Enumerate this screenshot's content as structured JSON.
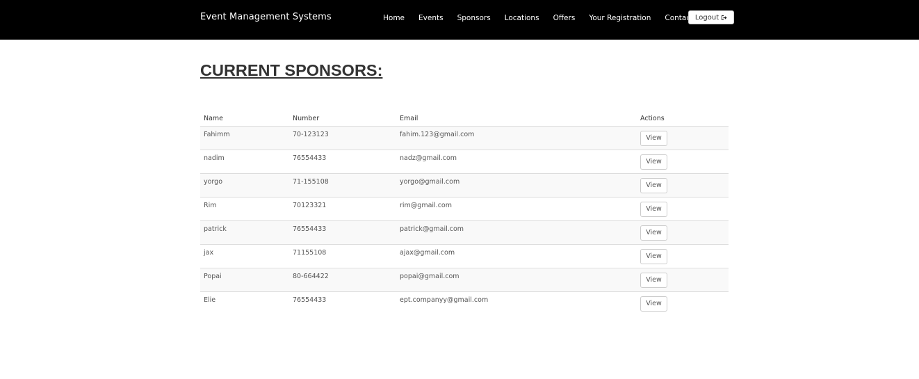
{
  "navbar": {
    "brand": "Event Management Systems",
    "links": [
      "Home",
      "Events",
      "Sponsors",
      "Locations",
      "Offers",
      "Your Registration",
      "Contact Us"
    ],
    "logout_label": "Logout"
  },
  "page": {
    "title": "CURRENT SPONSORS:"
  },
  "table": {
    "headers": [
      "Name",
      "Number",
      "Email",
      "Actions"
    ],
    "rows": [
      {
        "name": "Fahimm",
        "number": "70-123123",
        "email": "fahim.123@gmail.com",
        "action": "View"
      },
      {
        "name": "nadim",
        "number": "76554433",
        "email": "nadz@gmail.com",
        "action": "View"
      },
      {
        "name": "yorgo",
        "number": "71-155108",
        "email": "yorgo@gmail.com",
        "action": "View"
      },
      {
        "name": "Rim",
        "number": "70123321",
        "email": "rim@gmail.com",
        "action": "View"
      },
      {
        "name": "patrick",
        "number": "76554433",
        "email": "patrick@gmail.com",
        "action": "View"
      },
      {
        "name": "jax",
        "number": "71155108",
        "email": "ajax@gmail.com",
        "action": "View"
      },
      {
        "name": "Popai",
        "number": "80-664422",
        "email": "popai@gmail.com",
        "action": "View"
      },
      {
        "name": "Elie",
        "number": "76554433",
        "email": "ept.companyy@gmail.com",
        "action": "View"
      }
    ]
  },
  "colors": {
    "navbar_bg": "#000000",
    "navbar_text": "#ffffff",
    "stripe_row": "#f9f9f9",
    "row_border": "#dddddd"
  },
  "icons": {
    "logout": "sign-out-icon"
  }
}
